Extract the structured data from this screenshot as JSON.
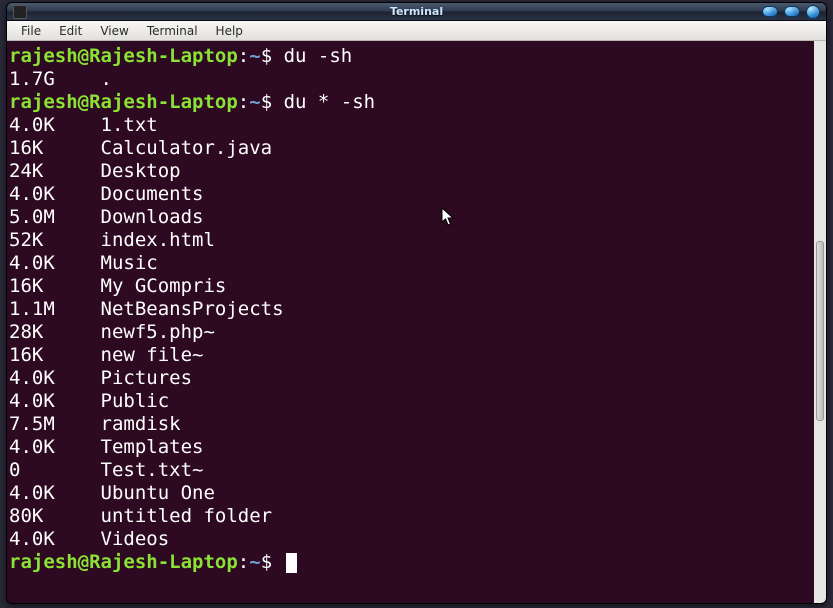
{
  "window": {
    "title": "Terminal"
  },
  "menu": {
    "items": [
      "File",
      "Edit",
      "View",
      "Terminal",
      "Help"
    ]
  },
  "prompt": {
    "userhost": "rajesh@Rajesh-Laptop",
    "sep": ":",
    "path": "~",
    "symbol": "$"
  },
  "commands": [
    {
      "cmd": "du -sh"
    },
    {
      "cmd": "du * -sh"
    }
  ],
  "output1": [
    {
      "size": "1.7G",
      "name": "."
    }
  ],
  "output2": [
    {
      "size": "4.0K",
      "name": "1.txt"
    },
    {
      "size": "16K",
      "name": "Calculator.java"
    },
    {
      "size": "24K",
      "name": "Desktop"
    },
    {
      "size": "4.0K",
      "name": "Documents"
    },
    {
      "size": "5.0M",
      "name": "Downloads"
    },
    {
      "size": "52K",
      "name": "index.html"
    },
    {
      "size": "4.0K",
      "name": "Music"
    },
    {
      "size": "16K",
      "name": "My GCompris"
    },
    {
      "size": "1.1M",
      "name": "NetBeansProjects"
    },
    {
      "size": "28K",
      "name": "newf5.php~"
    },
    {
      "size": "16K",
      "name": "new file~"
    },
    {
      "size": "4.0K",
      "name": "Pictures"
    },
    {
      "size": "4.0K",
      "name": "Public"
    },
    {
      "size": "7.5M",
      "name": "ramdisk"
    },
    {
      "size": "4.0K",
      "name": "Templates"
    },
    {
      "size": "0",
      "name": "Test.txt~"
    },
    {
      "size": "4.0K",
      "name": "Ubuntu One"
    },
    {
      "size": "80K",
      "name": "untitled folder"
    },
    {
      "size": "4.0K",
      "name": "Videos"
    }
  ]
}
